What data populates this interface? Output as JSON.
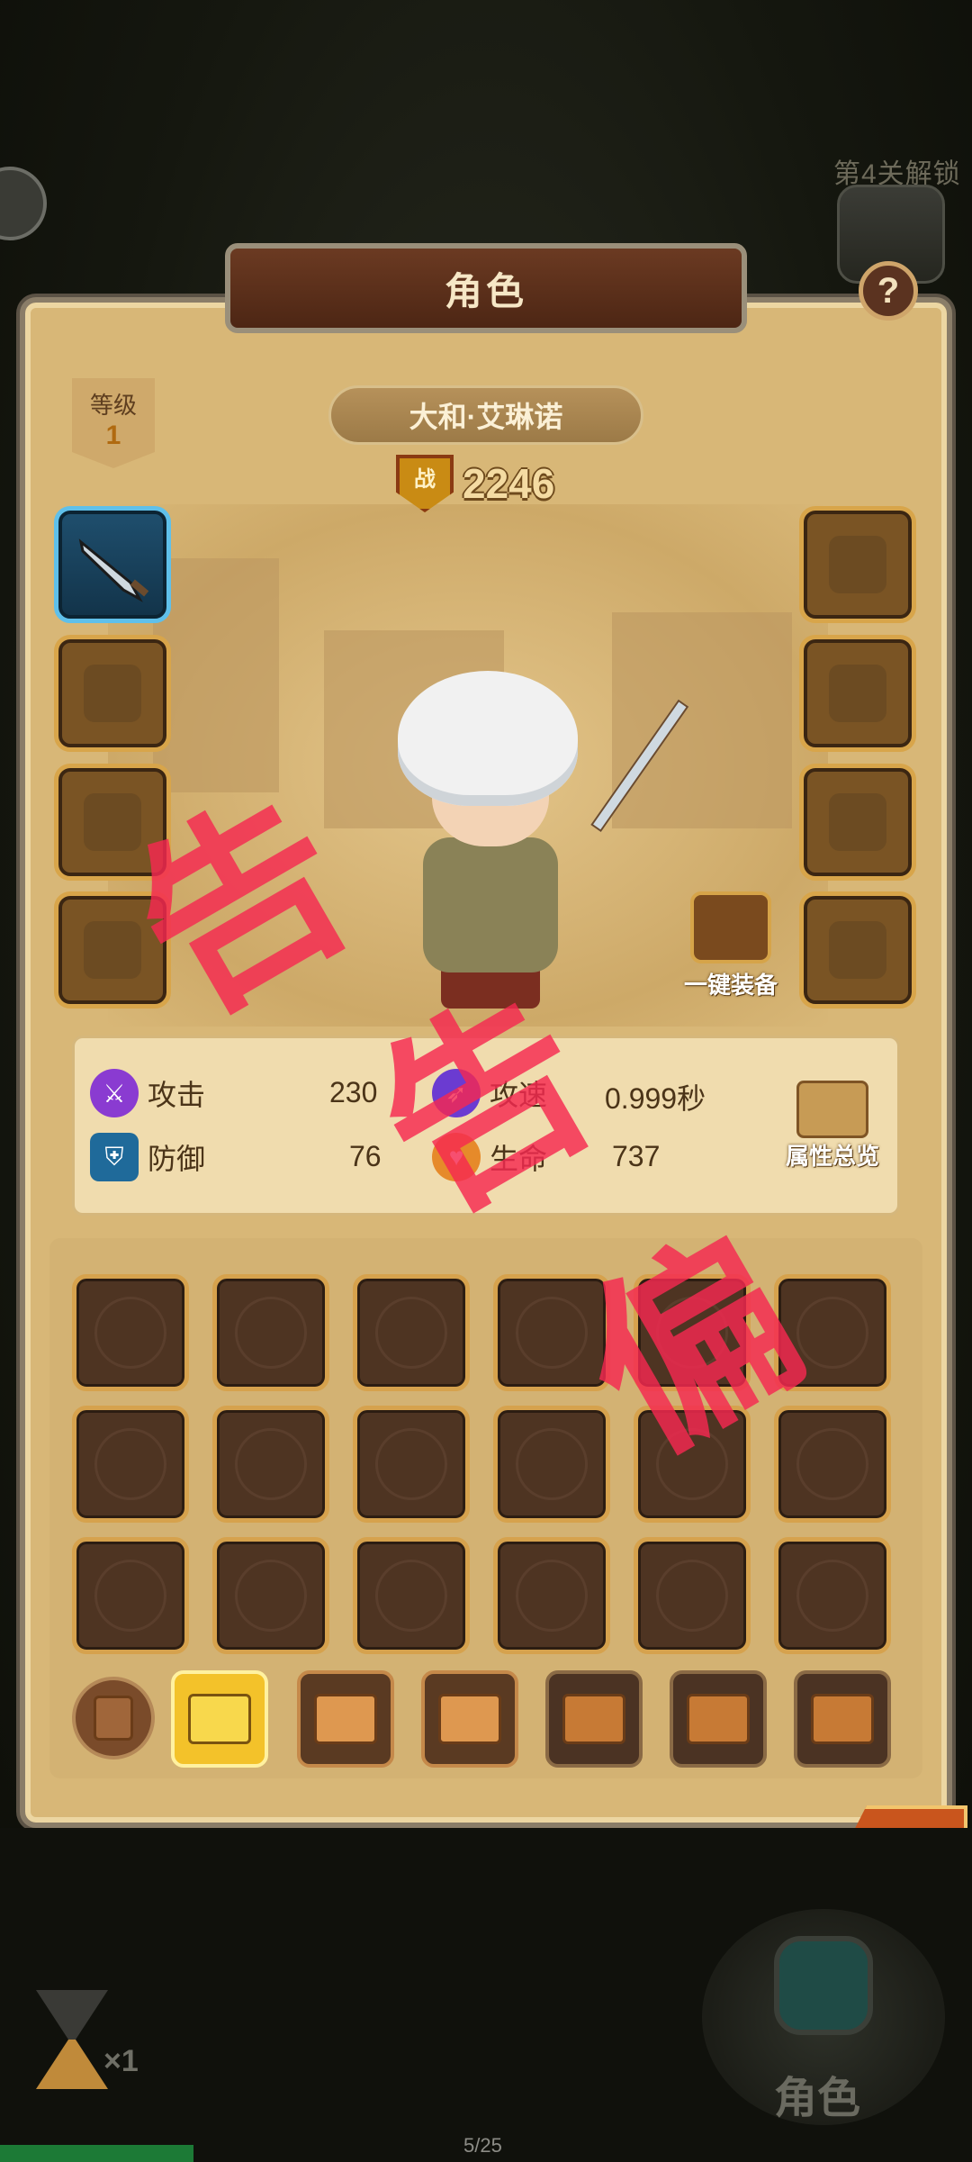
{
  "header": {
    "unlock_text": "第4关解锁",
    "title": "角色",
    "help_symbol": "?"
  },
  "character": {
    "level_label": "等级",
    "level_value": "1",
    "name": "大和·艾琳诺",
    "power_badge": "战",
    "power_value": "2246",
    "equip_all_label": "一键装备"
  },
  "stats": {
    "attack_label": "攻击",
    "attack_value": "230",
    "attack_speed_label": "攻速",
    "attack_speed_value": "0.999秒",
    "defense_label": "防御",
    "defense_value": "76",
    "hp_label": "生命",
    "hp_value": "737",
    "overview_label": "属性总览"
  },
  "watermark": [
    "告",
    "告",
    "偏"
  ],
  "bottom": {
    "multiplier": "×1",
    "role_label": "角色",
    "page_indicator": "5/25"
  },
  "colors": {
    "panel": "#d8b777",
    "slot_border": "#d8a54a",
    "active_tab": "#f3c22a",
    "watermark": "#f52850"
  }
}
